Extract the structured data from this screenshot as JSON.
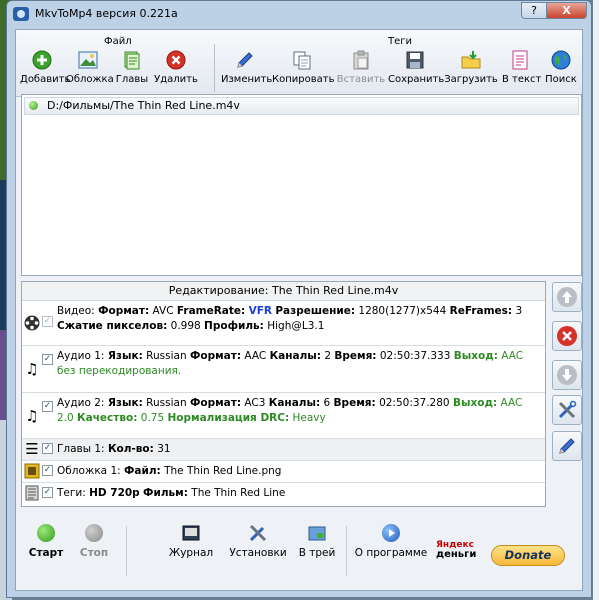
{
  "window": {
    "title": "MkvToMp4 версия 0.221a",
    "help_label": "?",
    "close_label": "X"
  },
  "toolbar": {
    "file_group": "Файл",
    "tags_group": "Теги",
    "buttons": {
      "add": "Добавить",
      "cover": "Обложка",
      "chapters": "Главы",
      "delete": "Удалить",
      "edit": "Изменить",
      "copy": "Копировать",
      "paste": "Вставить",
      "save": "Сохранить",
      "load": "Загрузить",
      "to_text": "В текст",
      "search": "Поиск"
    }
  },
  "file_list": {
    "items": [
      {
        "path": "D:/Фильмы/The Thin Red Line.m4v",
        "status_color": "#33a01f"
      }
    ]
  },
  "edit_panel": {
    "header": "Редактирование: The Thin Red Line.m4v",
    "video": {
      "prefix": "Видео:",
      "format_k": "Формат:",
      "format_v": "AVC",
      "fr_k": "FrameRate:",
      "fr_v": "VFR",
      "res_k": "Разрешение:",
      "res_v": "1280(1277)x544",
      "ref_k": "ReFrames:",
      "ref_v": "3",
      "comp_k": "Сжатие пикселов:",
      "comp_v": "0.998",
      "prof_k": "Профиль:",
      "prof_v": "High@L3.1"
    },
    "audio1": {
      "prefix": "Аудио 1:",
      "lang_k": "Язык:",
      "lang_v": "Russian",
      "format_k": "Формат:",
      "format_v": "AAC",
      "ch_k": "Каналы:",
      "ch_v": "2",
      "time_k": "Время:",
      "time_v": "02:50:37.333",
      "out_k": "Выход:",
      "out_v": "AAC без перекодирования."
    },
    "audio2": {
      "prefix": "Аудио 2:",
      "lang_k": "Язык:",
      "lang_v": "Russian",
      "format_k": "Формат:",
      "format_v": "AC3",
      "ch_k": "Каналы:",
      "ch_v": "6",
      "time_k": "Время:",
      "time_v": "02:50:37.280",
      "out_k": "Выход:",
      "out_v": "AAC 2.0",
      "q_k": "Качество:",
      "q_v": "0.75",
      "drc_k": "Нормализация DRC:",
      "drc_v": "Heavy"
    },
    "chapters": {
      "prefix": "Главы 1:",
      "count_k": "Кол-во:",
      "count_v": "31"
    },
    "cover": {
      "prefix": "Обложка 1:",
      "file_k": "Файл:",
      "file_v": "The Thin Red Line.png"
    },
    "tags": {
      "prefix": "Теги:",
      "hd_k": "HD 720p",
      "film_k": "Фильм:",
      "film_v": "The Thin Red Line"
    }
  },
  "bottom": {
    "start": "Старт",
    "stop": "Стоп",
    "journal": "Журнал",
    "settings": "Установки",
    "tray": "В трей",
    "about": "О программе",
    "yandex_line1": "Яндекс",
    "yandex_line2": "деньги",
    "donate": "Donate"
  }
}
